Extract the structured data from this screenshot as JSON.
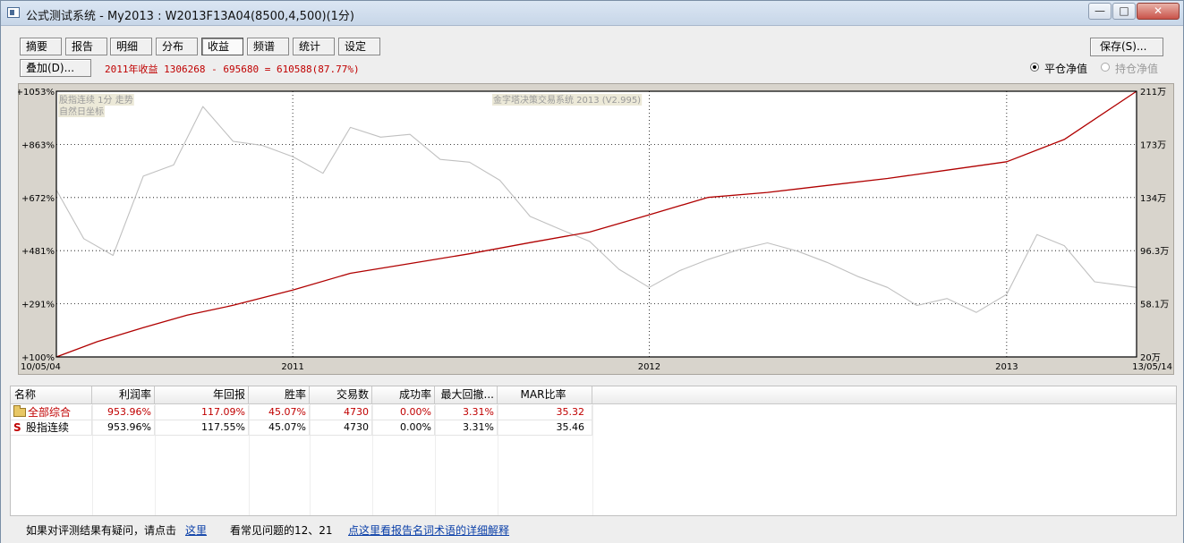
{
  "window": {
    "title": "公式测试系统 - My2013 : W2013F13A04(8500,4,500)(1分)",
    "controls": {
      "minimize": "—",
      "maximize": "□",
      "close": "✕"
    }
  },
  "toolbar": {
    "tabs": [
      "摘要",
      "报告",
      "明细",
      "分布",
      "收益",
      "频谱",
      "统计",
      "设定"
    ],
    "active_tab": "收益",
    "save_label": "保存(S)...",
    "overlay_label": "叠加(D)..."
  },
  "summary_text": "2011年收益 1306268 - 695680 = 610588(87.77%)",
  "view_options": {
    "flat_equity": "平仓净值",
    "open_equity": "持仓净值",
    "selected": "flat_equity"
  },
  "chart_data": {
    "type": "line",
    "overlay_labels": [
      "股指连续 1分 走势",
      "自然日坐标"
    ],
    "watermark": "金字塔决策交易系统 2013 (V2.995)",
    "left_axis": {
      "ticks": [
        "+1053%",
        "+863%",
        "+672%",
        "+481%",
        "+291%",
        "+100%"
      ],
      "range": [
        100,
        1053
      ]
    },
    "right_axis": {
      "ticks": [
        "211万",
        "173万",
        "134万",
        "96.3万",
        "58.1万",
        "20万"
      ],
      "range": [
        20,
        211
      ],
      "unit": "万"
    },
    "x_axis": {
      "ticks": [
        "10/05/04",
        "2011",
        "2012",
        "2013",
        "13/05/14"
      ],
      "range": [
        "2010-05-04",
        "2013-05-14"
      ]
    },
    "series": [
      {
        "color": "#b00000",
        "axis": "left",
        "x": [
          "2010-05-04",
          "2010-06-15",
          "2010-08-01",
          "2010-09-15",
          "2010-11-01",
          "2011-01-01",
          "2011-03-01",
          "2011-05-01",
          "2011-07-01",
          "2011-09-01",
          "2011-11-01",
          "2012-01-01",
          "2012-03-01",
          "2012-05-01",
          "2012-07-01",
          "2012-09-01",
          "2012-11-01",
          "2013-01-01",
          "2013-03-01",
          "2013-05-14"
        ],
        "values": [
          100,
          155,
          205,
          250,
          285,
          340,
          400,
          435,
          470,
          510,
          548,
          610,
          672,
          690,
          715,
          740,
          770,
          800,
          880,
          1053
        ]
      },
      {
        "color": "#c0c0c0",
        "axis": "right",
        "x": [
          "2010-05-04",
          "2010-06-01",
          "2010-07-01",
          "2010-08-01",
          "2010-09-01",
          "2010-10-01",
          "2010-11-01",
          "2010-12-01",
          "2011-01-01",
          "2011-02-01",
          "2011-03-01",
          "2011-04-01",
          "2011-05-01",
          "2011-06-01",
          "2011-07-01",
          "2011-08-01",
          "2011-09-01",
          "2011-10-01",
          "2011-11-01",
          "2011-12-01",
          "2012-01-01",
          "2012-02-01",
          "2012-03-01",
          "2012-04-01",
          "2012-05-01",
          "2012-06-01",
          "2012-07-01",
          "2012-08-01",
          "2012-09-01",
          "2012-10-01",
          "2012-11-01",
          "2012-12-01",
          "2013-01-01",
          "2013-02-01",
          "2013-03-01",
          "2013-04-01",
          "2013-05-14"
        ],
        "values": [
          140,
          105,
          93,
          150,
          158,
          200,
          175,
          172,
          164,
          152,
          185,
          178,
          180,
          162,
          160,
          147,
          121,
          112,
          103,
          83,
          70,
          82,
          90,
          97,
          102,
          96,
          88,
          78,
          70,
          57,
          62,
          52,
          65,
          108,
          100,
          74,
          70
        ]
      }
    ]
  },
  "results_table": {
    "columns": [
      "名称",
      "利润率",
      "年回报",
      "胜率",
      "交易数",
      "成功率",
      "最大回撤...",
      "MAR比率"
    ],
    "rows": [
      {
        "icon": "folder-icon",
        "name": "全部综合",
        "profit": "953.96%",
        "annual": "117.09%",
        "win": "45.07%",
        "trades": "4730",
        "success": "0.00%",
        "drawdown": "3.31%",
        "mar": "35.32"
      },
      {
        "icon": "s-icon",
        "icon_text": "S",
        "name": "股指连续",
        "profit": "953.96%",
        "annual": "117.55%",
        "win": "45.07%",
        "trades": "4730",
        "success": "0.00%",
        "drawdown": "3.31%",
        "mar": "35.46"
      }
    ]
  },
  "footer": {
    "question_text": "如果对评测结果有疑问，请点击",
    "here_link": "这里",
    "faq_text": "看常见问题的12、21",
    "glossary_link": "点这里看报告名词术语的详细解释"
  }
}
